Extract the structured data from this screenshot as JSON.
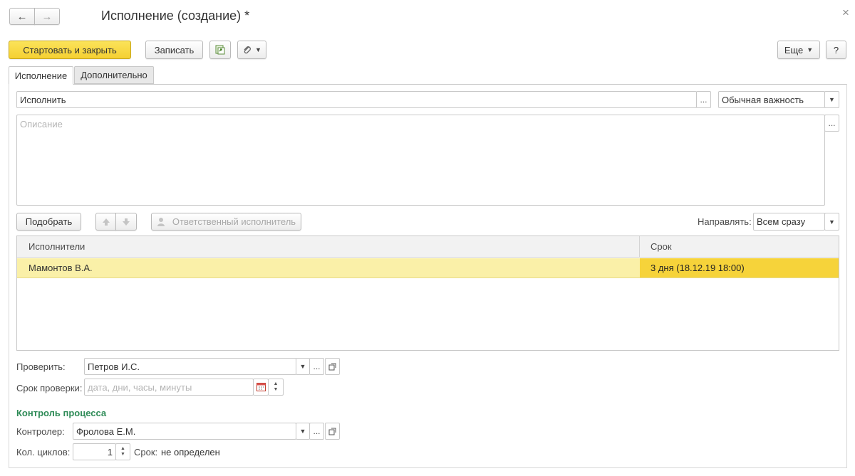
{
  "window": {
    "title": "Исполнение (создание) *",
    "nav_back": "←",
    "nav_forward": "→",
    "close": "×"
  },
  "toolbar": {
    "start_close_label": "Стартовать и закрыть",
    "save_label": "Записать",
    "more_label": "Еще",
    "help_label": "?"
  },
  "tabs": [
    {
      "label": "Исполнение",
      "active": true
    },
    {
      "label": "Дополнительно",
      "active": false
    }
  ],
  "task": {
    "name_value": "Исполнить",
    "importance_value": "Обычная важность",
    "description_placeholder": "Описание",
    "ellipsis": "..."
  },
  "performers_toolbar": {
    "select_label": "Подобрать",
    "responsible_label": "Ответственный исполнитель",
    "send_label": "Направлять:",
    "send_value": "Всем сразу"
  },
  "performers_table": {
    "columns": [
      "Исполнители",
      "Срок"
    ],
    "rows": [
      {
        "performer": "Мамонтов В.А.",
        "deadline": "3 дня (18.12.19 18:00)"
      }
    ]
  },
  "check": {
    "label": "Проверить:",
    "value": "Петров И.С.",
    "deadline_label": "Срок проверки:",
    "deadline_placeholder": "дата, дни, часы, минуты"
  },
  "process_control": {
    "heading": "Контроль процесса",
    "controller_label": "Контролер:",
    "controller_value": "Фролова Е.М.",
    "cycles_label": "Кол. циклов:",
    "cycles_value": "1",
    "term_label": "Срок:",
    "term_value": "не определен"
  },
  "colors": {
    "accent_yellow": "#f5d032",
    "row_highlight": "#faf0a8",
    "cell_highlight": "#f6d33a",
    "section_heading": "#2e8b57"
  }
}
